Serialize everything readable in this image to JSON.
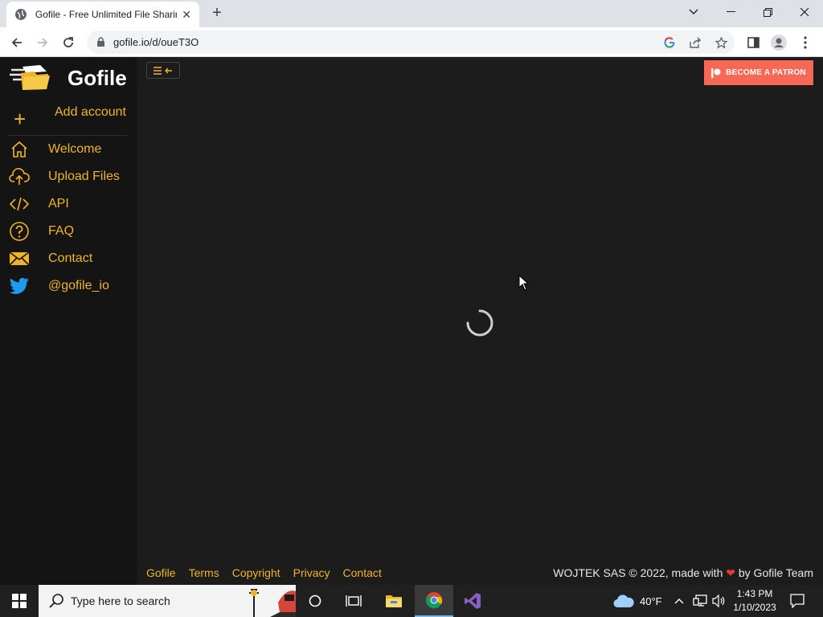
{
  "browser": {
    "tab_title": "Gofile - Free Unlimited File Sharin",
    "url": "gofile.io/d/oueT3O"
  },
  "sidebar": {
    "brand": "Gofile",
    "add_account": "Add account",
    "items": [
      {
        "label": "Welcome",
        "icon": "home-icon"
      },
      {
        "label": "Upload Files",
        "icon": "cloud-upload-icon"
      },
      {
        "label": "API",
        "icon": "code-icon"
      },
      {
        "label": "FAQ",
        "icon": "question-icon"
      },
      {
        "label": "Contact",
        "icon": "envelope-icon"
      },
      {
        "label": "@gofile_io",
        "icon": "twitter-icon"
      }
    ]
  },
  "header": {
    "patron_label": "BECOME A PATRON"
  },
  "footer": {
    "links": [
      "Gofile",
      "Terms",
      "Copyright",
      "Privacy",
      "Contact"
    ],
    "copyright_prefix": "WOJTEK SAS © 2022, made with",
    "heart": "❤",
    "copyright_suffix": "by Gofile Team"
  },
  "taskbar": {
    "search_placeholder": "Type here to search",
    "weather": "40°F",
    "time": "1:43 PM",
    "date": "1/10/2023"
  },
  "colors": {
    "accent": "#f0b429",
    "patron": "#f96854",
    "page_bg": "#1c1c1c",
    "sidebar_bg": "#141414"
  }
}
